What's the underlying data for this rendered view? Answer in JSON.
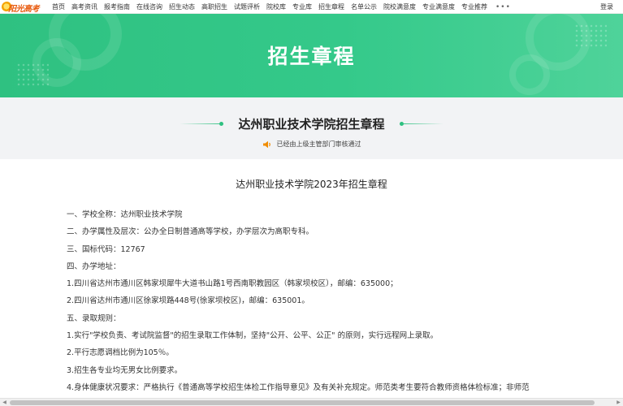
{
  "logo": {
    "text": "阳光高考",
    "icon": "sun-logo-icon"
  },
  "nav": {
    "items": [
      "首页",
      "高考资讯",
      "报考指南",
      "在线咨询",
      "招生动态",
      "高职招生",
      "试题评析",
      "院校库",
      "专业库",
      "招生章程",
      "名单公示",
      "院校满意度",
      "专业满意度",
      "专业推荐"
    ],
    "more_icon": "•••",
    "login": "登录"
  },
  "banner": {
    "title": "招生章程",
    "accent_color": "#2fc181"
  },
  "header": {
    "page_heading": "达州职业技术学院招生章程",
    "notice": "已经由上级主管部门审核通过",
    "notice_icon": "speaker-icon"
  },
  "document": {
    "title": "达州职业技术学院2023年招生章程",
    "lines": [
      "一、学校全称：达州职业技术学院",
      "二、办学属性及层次：公办全日制普通高等学校，办学层次为高职专科。",
      "三、国标代码：12767",
      "四、办学地址：",
      "1.四川省达州市通川区韩家坝犀牛大道书山路1号西南职教园区（韩家坝校区），邮编：635000；",
      "2.四川省达州市通川区徐家坝路448号(徐家坝校区)，邮编：635001。",
      "五、录取规则：",
      "1.实行\"学校负责、考试院监督\"的招生录取工作体制，坚持\"公开、公平、公正\" 的原则，实行远程网上录取。",
      "2.平行志愿调档比例为105％。",
      "3.招生各专业均无男女比例要求。",
      "4.身体健康状况要求：严格执行《普通高等学校招生体检工作指导意见》及有关补充规定。师范类考生要符合教师资格体检标准；非师范"
    ]
  }
}
